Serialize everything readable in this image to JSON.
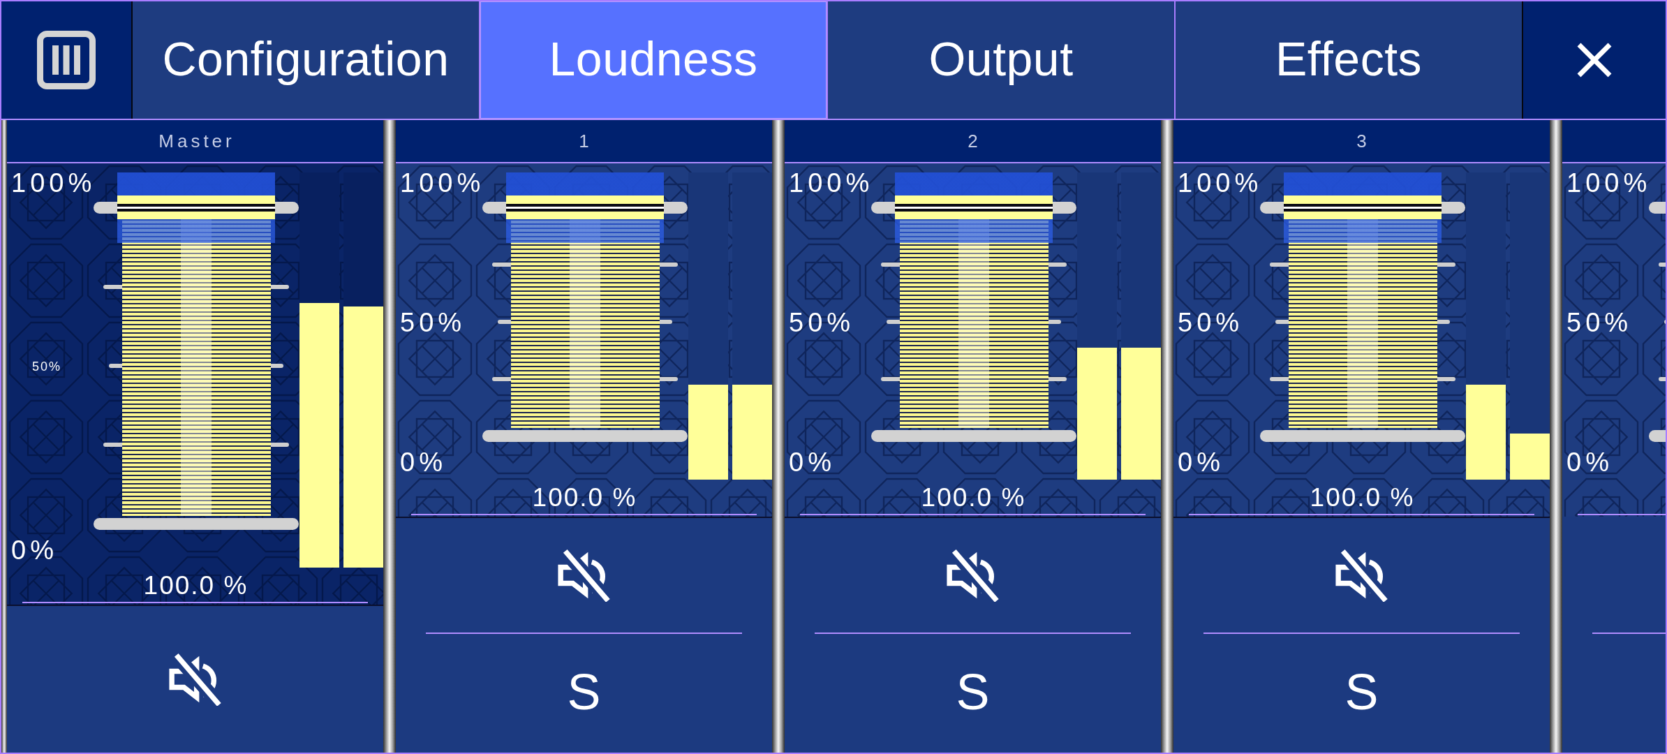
{
  "toolbar": {
    "tabs": [
      {
        "label": "Configuration",
        "selected": false
      },
      {
        "label": "Loudness",
        "selected": true
      },
      {
        "label": "Output",
        "selected": false
      },
      {
        "label": "Effects",
        "selected": false
      }
    ]
  },
  "strips": [
    {
      "kind": "master",
      "name": "Master",
      "scale": [
        "100%",
        "50%",
        "0%"
      ],
      "fader": {
        "level": 1,
        "reading": "100.0 %"
      },
      "meters": [
        {
          "level": 0.67
        },
        {
          "level": 0.66
        }
      ],
      "mute": {
        "muted": false
      }
    },
    {
      "kind": "channel",
      "name": "1",
      "scale": [
        "100%",
        "50%",
        "0%"
      ],
      "fader": {
        "level": 1,
        "reading": "100.0 %"
      },
      "meters": [
        {
          "level": 0.31
        },
        {
          "level": 0.31
        }
      ],
      "mute": {
        "muted": false
      },
      "solo": {
        "label": "S",
        "soloed": false
      }
    },
    {
      "kind": "channel",
      "name": "2",
      "scale": [
        "100%",
        "50%",
        "0%"
      ],
      "fader": {
        "level": 1,
        "reading": "100.0 %"
      },
      "meters": [
        {
          "level": 0.43
        },
        {
          "level": 0.43
        }
      ],
      "mute": {
        "muted": false
      },
      "solo": {
        "label": "S",
        "soloed": false
      }
    },
    {
      "kind": "channel",
      "name": "3",
      "scale": [
        "100%",
        "50%",
        "0%"
      ],
      "fader": {
        "level": 1,
        "reading": "100.0 %"
      },
      "meters": [
        {
          "level": 0.31
        },
        {
          "level": 0.15
        }
      ],
      "mute": {
        "muted": false
      },
      "solo": {
        "label": "S",
        "soloed": false
      }
    },
    {
      "kind": "channel",
      "scale": [
        "100%",
        "50%",
        "0%"
      ]
    }
  ]
}
